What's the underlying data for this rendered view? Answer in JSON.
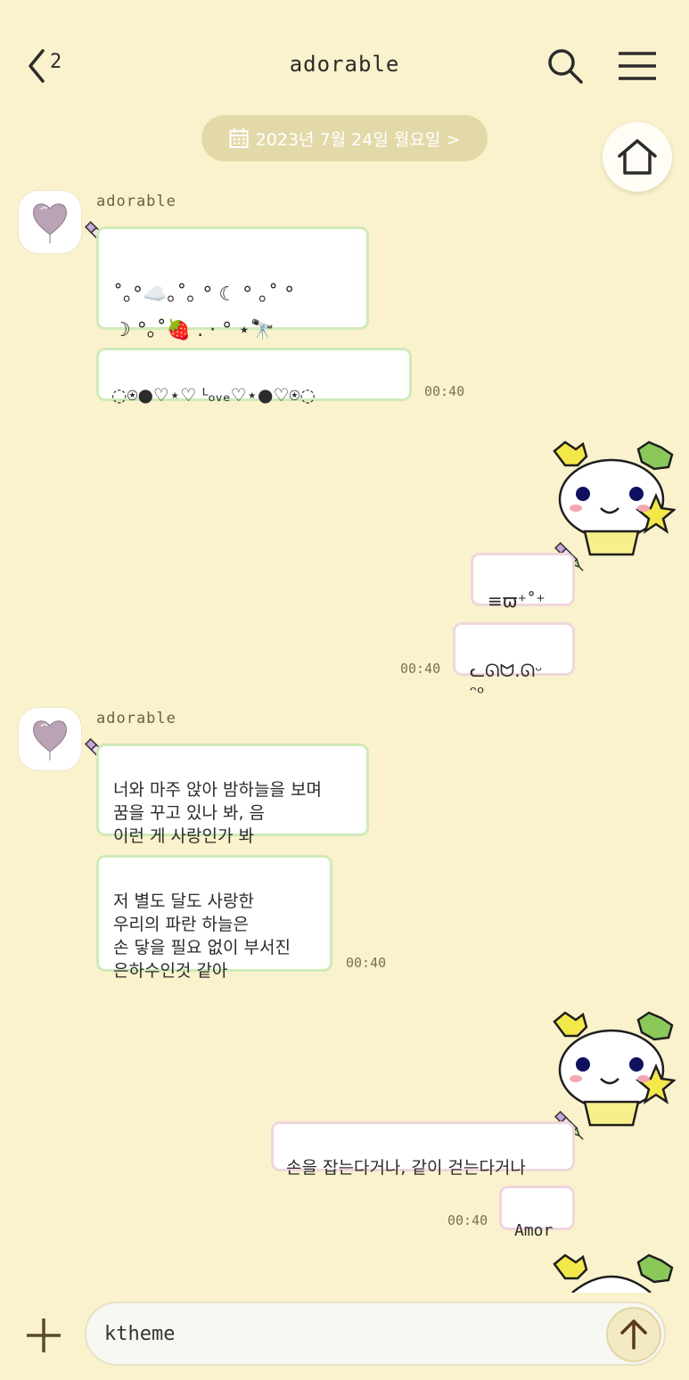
{
  "header": {
    "back_count": "2",
    "title": "adorable"
  },
  "date_pill": {
    "label": "2023년 7월 24일 월요일 >"
  },
  "messages": {
    "m1": {
      "sender": "adorable",
      "text": "˚｡°☁️｡˚｡ ° ☾ ° ｡˚ °\n☽ °｡˚🍓 . · ° ⋆🔭",
      "time": ""
    },
    "m2": {
      "text": "◌⍟●♡⋆♡ ᴸₒᵥₑ♡⋆●♡⍟◌",
      "time": "00:40"
    },
    "m3": {
      "text": "≡ϖ⁺˚⁺",
      "time": ""
    },
    "m4": {
      "text": "ᓚᘏᗢ.ᘏᵕ ᵔᵒ",
      "time": "00:40"
    },
    "m5": {
      "sender": "adorable",
      "text": "너와 마주 앉아 밤하늘을 보며\n꿈을 꾸고 있나 봐, 음\n이런 게 사랑인가 봐",
      "time": ""
    },
    "m6": {
      "text": "저 별도 달도 사랑한\n우리의 파란 하늘은\n손 닿을 필요 없이 부서진\n은하수인것 같아",
      "time": "00:40"
    },
    "m7": {
      "text": "손을 잡는다거나, 같이 걷는다거나",
      "time": ""
    },
    "m8": {
      "text": "Amor",
      "time": "00:40"
    }
  },
  "input": {
    "value": "ktheme",
    "placeholder": ""
  },
  "colors": {
    "background": "#faf2cc",
    "incoming_border": "#cfeab8",
    "outgoing_border": "#f0d6dc",
    "date_pill": "#e3d9a8"
  },
  "icons": [
    "chevron-left-icon",
    "search-icon",
    "menu-icon",
    "calendar-icon",
    "home-icon",
    "heart-balloon-avatar",
    "pen-icon",
    "bunny-sticker",
    "plus-icon",
    "arrow-up-icon"
  ]
}
